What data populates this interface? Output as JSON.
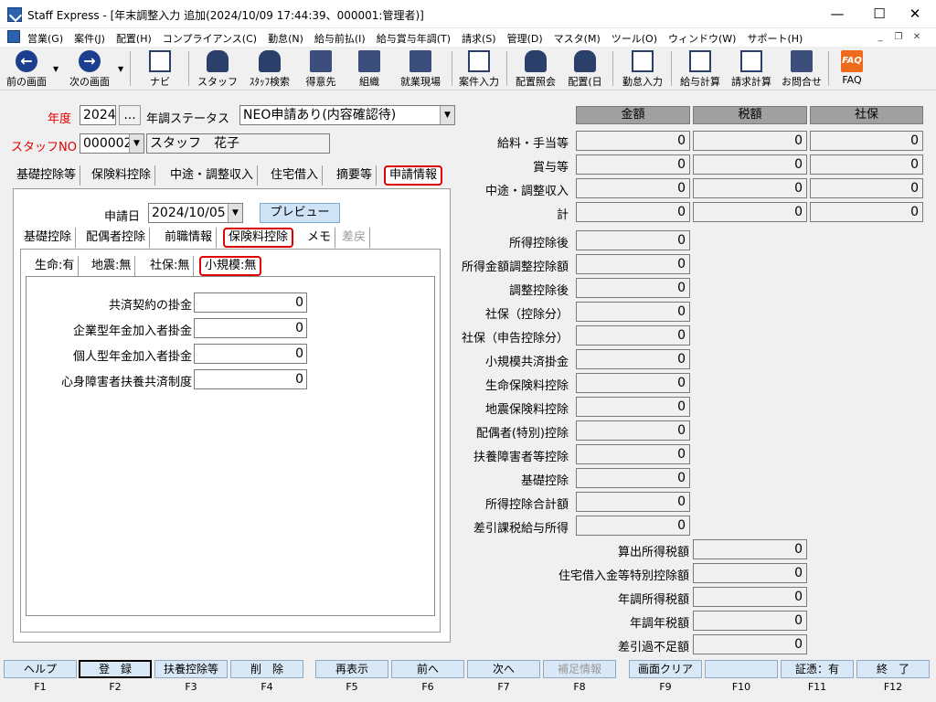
{
  "window": {
    "title": "Staff Express - [年末調整入力 追加(2024/10/09 17:44:39、000001:管理者)]",
    "minimize": "—",
    "maximize": "☐",
    "close": "✕"
  },
  "menu": [
    "営業(G)",
    "案件(J)",
    "配置(H)",
    "コンプライアンス(C)",
    "勤怠(N)",
    "給与前払(I)",
    "給与賞与年調(T)",
    "請求(S)",
    "管理(D)",
    "マスタ(M)",
    "ツール(O)",
    "ウィンドウ(W)",
    "サポート(H)"
  ],
  "toolbar": {
    "prev": "前の画面",
    "next": "次の画面",
    "navi": "ナビ",
    "staff": "スタッフ",
    "staff_search": "ｽﾀｯﾌ検索",
    "client": "得意先",
    "org": "組織",
    "site": "就業現場",
    "case_input": "案件入力",
    "assign_query": "配置照会",
    "assign_day": "配置(日",
    "attendance": "勤怠入力",
    "salary_calc": "給与計算",
    "billing_calc": "請求計算",
    "inquiry": "お問合せ",
    "faq": "FAQ",
    "faq_icon": "FAQ"
  },
  "form": {
    "year_label": "年度",
    "year_value": "2024",
    "year_btn": "...",
    "status_label": "年調ステータス",
    "status_value": "NEO申請あり(内容確認待)",
    "staffno_label": "スタッフNO",
    "staffno_value": "000002",
    "staff_name": "スタッフ　花子"
  },
  "tabs1": [
    "基礎控除等",
    "保険料控除",
    "中途・調整収入",
    "住宅借入",
    "摘要等",
    "申請情報"
  ],
  "apply": {
    "date_label": "申請日",
    "date_value": "2024/10/05",
    "preview": "プレビュー"
  },
  "tabs2": [
    "基礎控除",
    "配偶者控除",
    "前職情報",
    "保険料控除",
    "メモ",
    "差戻"
  ],
  "tabs3": [
    "生命:有",
    "地震:無",
    "社保:無",
    "小規模:無"
  ],
  "small_scale": [
    {
      "label": "共済契約の掛金",
      "value": "0"
    },
    {
      "label": "企業型年金加入者掛金",
      "value": "0"
    },
    {
      "label": "個人型年金加入者掛金",
      "value": "0"
    },
    {
      "label": "心身障害者扶養共済制度",
      "value": "0"
    }
  ],
  "summary": {
    "headers": [
      "金額",
      "税額",
      "社保"
    ],
    "rows3": [
      {
        "label": "給料・手当等",
        "values": [
          "0",
          "0",
          "0"
        ]
      },
      {
        "label": "賞与等",
        "values": [
          "0",
          "0",
          "0"
        ]
      },
      {
        "label": "中途・調整収入",
        "values": [
          "0",
          "0",
          "0"
        ]
      },
      {
        "label": "計",
        "values": [
          "0",
          "0",
          "0"
        ]
      }
    ],
    "rows1": [
      {
        "label": "所得控除後",
        "value": "0"
      },
      {
        "label": "所得金額調整控除額",
        "value": "0"
      },
      {
        "label": "調整控除後",
        "value": "0"
      },
      {
        "label": "社保（控除分）",
        "value": "0"
      },
      {
        "label": "社保（申告控除分）",
        "value": "0"
      },
      {
        "label": "小規模共済掛金",
        "value": "0"
      },
      {
        "label": "生命保険料控除",
        "value": "0"
      },
      {
        "label": "地震保険料控除",
        "value": "0"
      },
      {
        "label": "配偶者(特別)控除",
        "value": "0"
      },
      {
        "label": "扶養障害者等控除",
        "value": "0"
      },
      {
        "label": "基礎控除",
        "value": "0"
      },
      {
        "label": "所得控除合計額",
        "value": "0"
      },
      {
        "label": "差引課税給与所得",
        "value": "0"
      }
    ],
    "rows2": [
      {
        "label": "算出所得税額",
        "value": "0"
      },
      {
        "label": "住宅借入金等特別控除額",
        "value": "0"
      },
      {
        "label": "年調所得税額",
        "value": "0"
      },
      {
        "label": "年調年税額",
        "value": "0"
      },
      {
        "label": "差引過不足額",
        "value": "0"
      }
    ]
  },
  "fkeys": [
    {
      "label": "ヘルプ",
      "key": "F1"
    },
    {
      "label": "登　録",
      "key": "F2"
    },
    {
      "label": "扶養控除等",
      "key": "F3"
    },
    {
      "label": "削　除",
      "key": "F4"
    },
    {
      "label": "再表示",
      "key": "F5"
    },
    {
      "label": "前へ",
      "key": "F6"
    },
    {
      "label": "次へ",
      "key": "F7"
    },
    {
      "label": "補足情報",
      "key": "F8"
    },
    {
      "label": "画面クリア",
      "key": "F9"
    },
    {
      "label": "",
      "key": "F10"
    },
    {
      "label": "証憑：有",
      "key": "F11"
    },
    {
      "label": "終　了",
      "key": "F12"
    }
  ]
}
